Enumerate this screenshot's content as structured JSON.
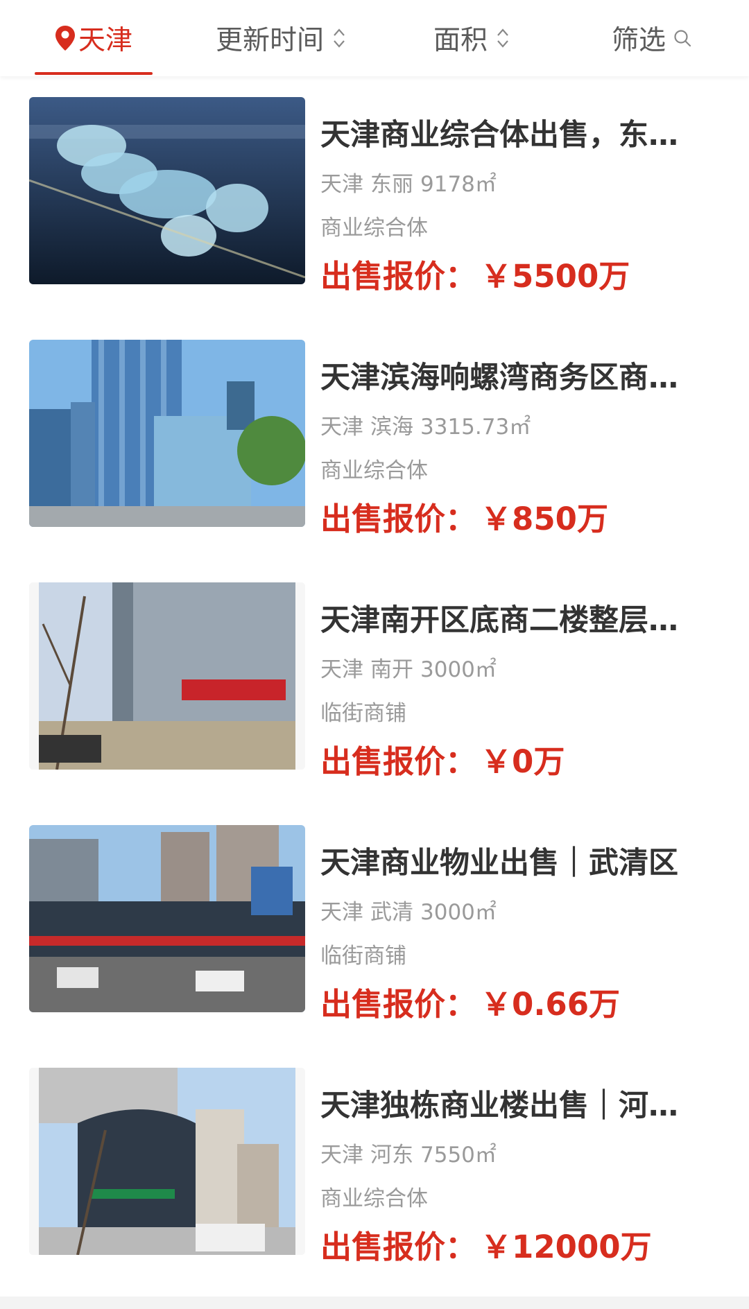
{
  "colors": {
    "accent": "#d72d1e",
    "text_primary": "#333333",
    "text_secondary": "#9a9a9a"
  },
  "tabs": {
    "city": {
      "label": "天津",
      "icon": "location-pin-icon"
    },
    "update_time": {
      "label": "更新时间",
      "icon": "sort-arrows-icon"
    },
    "area": {
      "label": "面积",
      "icon": "sort-arrows-icon"
    },
    "filter": {
      "label": "筛选",
      "icon": "search-icon"
    }
  },
  "listings": [
    {
      "title": "天津商业综合体出售，东丽区",
      "city": "天津",
      "district": "东丽",
      "area": "9178㎡",
      "type": "商业综合体",
      "price_label": "出售报价：",
      "price": "￥5500万"
    },
    {
      "title": "天津滨海响螺湾商务区商业综合体",
      "city": "天津",
      "district": "滨海",
      "area": "3315.73㎡",
      "type": "商业综合体",
      "price_label": "出售报价：",
      "price": "￥850万"
    },
    {
      "title": "天津南开区底商二楼整层出售",
      "city": "天津",
      "district": "南开",
      "area": "3000㎡",
      "type": "临街商铺",
      "price_label": "出售报价：",
      "price": "￥0万"
    },
    {
      "title": "天津商业物业出售｜武清区",
      "city": "天津",
      "district": "武清",
      "area": "3000㎡",
      "type": "临街商铺",
      "price_label": "出售报价：",
      "price": "￥0.66万"
    },
    {
      "title": "天津独栋商业楼出售｜河东区",
      "city": "天津",
      "district": "河东",
      "area": "7550㎡",
      "type": "商业综合体",
      "price_label": "出售报价：",
      "price": "￥12000万"
    }
  ]
}
